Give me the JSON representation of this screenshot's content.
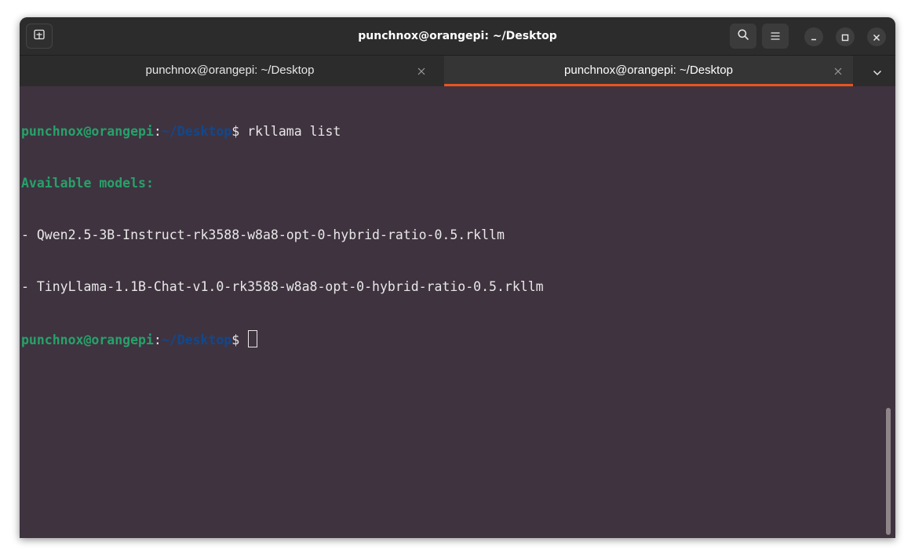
{
  "window": {
    "title": "punchnox@orangepi: ~/Desktop"
  },
  "header": {
    "new_tab_icon": "new-tab-icon",
    "search_icon": "search-icon",
    "menu_icon": "hamburger-menu-icon",
    "minimize_icon": "minimize-icon",
    "maximize_icon": "maximize-icon",
    "close_icon": "close-icon"
  },
  "tabs": [
    {
      "label": "punchnox@orangepi: ~/Desktop",
      "active": false
    },
    {
      "label": "punchnox@orangepi: ~/Desktop",
      "active": true
    }
  ],
  "terminal": {
    "prompt_user": "punchnox@orangepi",
    "prompt_colon": ":",
    "prompt_path": "~/Desktop",
    "prompt_dollar": "$",
    "command": " rkllama list",
    "heading": "Available models:",
    "models": [
      "- Qwen2.5-3B-Instruct-rk3588-w8a8-opt-0-hybrid-ratio-0.5.rkllm",
      "- TinyLlama-1.1B-Chat-v1.0-rk3588-w8a8-opt-0-hybrid-ratio-0.5.rkllm"
    ],
    "prompt2_user": "punchnox@orangepi",
    "prompt2_colon": ":",
    "prompt2_path": "~/Desktop",
    "prompt2_dollar": "$ "
  },
  "colors": {
    "accent": "#e95420",
    "terminal_bg": "#3f3340",
    "prompt_user": "#26a269",
    "prompt_path": "#12488b",
    "header_bg": "#2c2c2c"
  }
}
